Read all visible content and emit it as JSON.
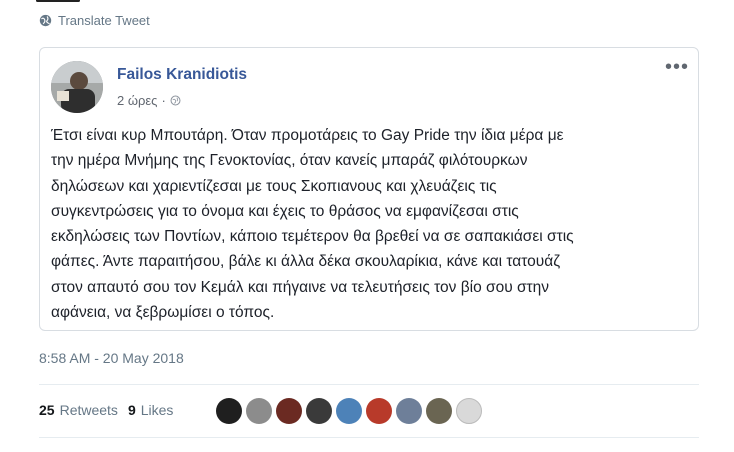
{
  "translate": {
    "label": "Translate Tweet",
    "icon": "globe-icon"
  },
  "post": {
    "author": "Failos Kranidiotis",
    "time": "2 ώρες",
    "separator": "·",
    "privacy_icon": "globe-icon",
    "menu_icon": "more-options-icon",
    "menu_label": "•••",
    "lines": [
      "Έτσι είναι κυρ Μπουτάρη. Όταν προμοτάρεις το Gay Pride την ίδια μέρα με",
      "την ημέρα Μνήμης της Γενοκτονίας, όταν κανείς μπαράζ φιλότουρκων",
      "δηλώσεων και χαριεντίζεσαι με τους Σκοπιανους και χλευάζεις τις",
      "συγκεντρώσεις για το όνομα και έχεις το θράσος να εμφανίζεσαι στις",
      "εκδηλώσεις των Ποντίων, κάποιο τεμέτερον θα βρεθεί να σε σαπακιάσει στις",
      "φάπες. Άντε παραιτήσου, βάλε κι άλλα δέκα σκουλαρίκια, κάνε και τατουάζ",
      "στον απαυτό σου τον Κεμάλ και πήγαινε να τελευτήσεις τον βίο σου στην",
      "αφάνεια, να ξεβρωμίσει ο τόπος."
    ]
  },
  "timestamp": "8:58 AM - 20 May 2018",
  "stats": {
    "retweets_count": "25",
    "retweets_label": "Retweets",
    "likes_count": "9",
    "likes_label": "Likes"
  },
  "likers": [
    {
      "name": "liker-avatar",
      "color": "#1f1f1f"
    },
    {
      "name": "liker-avatar",
      "color": "#8c8c8c"
    },
    {
      "name": "liker-avatar",
      "color": "#6b2a22"
    },
    {
      "name": "liker-avatar",
      "color": "#3a3a3a"
    },
    {
      "name": "liker-avatar",
      "color": "#4d82b8"
    },
    {
      "name": "liker-avatar",
      "color": "#b83a2a"
    },
    {
      "name": "liker-avatar",
      "color": "#6e7f99"
    },
    {
      "name": "liker-avatar",
      "color": "#6a6552"
    },
    {
      "name": "liker-avatar",
      "color": "#d9d9d9"
    }
  ],
  "colors": {
    "author": "#385898",
    "muted": "#657786",
    "border": "#d8dde2"
  }
}
